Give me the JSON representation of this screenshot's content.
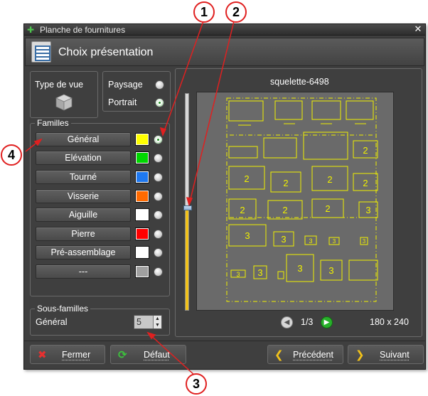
{
  "window": {
    "title": "Planche de fournitures",
    "close": "✕"
  },
  "header": {
    "title": "Choix présentation"
  },
  "view_type": {
    "label": "Type de vue"
  },
  "orientation": {
    "paysage": "Paysage",
    "portrait": "Portrait",
    "selected": "Portrait"
  },
  "familles": {
    "legend": "Familles",
    "items": [
      {
        "label": "Général",
        "color": "#ffff00",
        "checked": true
      },
      {
        "label": "Elévation",
        "color": "#00d800",
        "checked": false
      },
      {
        "label": "Tourné",
        "color": "#1e78f0",
        "checked": false
      },
      {
        "label": "Visserie",
        "color": "#ff6a00",
        "checked": false
      },
      {
        "label": "Aiguille",
        "color": "#ffffff",
        "checked": false
      },
      {
        "label": "Pierre",
        "color": "#ff0000",
        "checked": false
      },
      {
        "label": "Pré-assemblage",
        "color": "#ffffff",
        "checked": false
      },
      {
        "label": "---",
        "color": "#a0a0a0",
        "checked": false
      }
    ]
  },
  "sous_familles": {
    "legend": "Sous-familles",
    "label": "Général",
    "value": "5"
  },
  "preview": {
    "title": "squelette-6498",
    "page": "1/3",
    "size": "180 x 240",
    "slider_fraction": 0.47,
    "digits": [
      "2",
      "2",
      "2",
      "2",
      "2",
      "2",
      "2",
      "2",
      "3",
      "3",
      "3",
      "3",
      "3",
      "3",
      "3",
      "3",
      "3",
      "3"
    ]
  },
  "footer": {
    "fermer": "Fermer",
    "defaut": "Défaut",
    "precedent": "Précédent",
    "suivant": "Suivant"
  },
  "callouts": [
    "1",
    "2",
    "3",
    "4"
  ],
  "colors": {
    "accent": "#e02020",
    "drawing": "#f0f000",
    "background": "#3f3f3f"
  }
}
